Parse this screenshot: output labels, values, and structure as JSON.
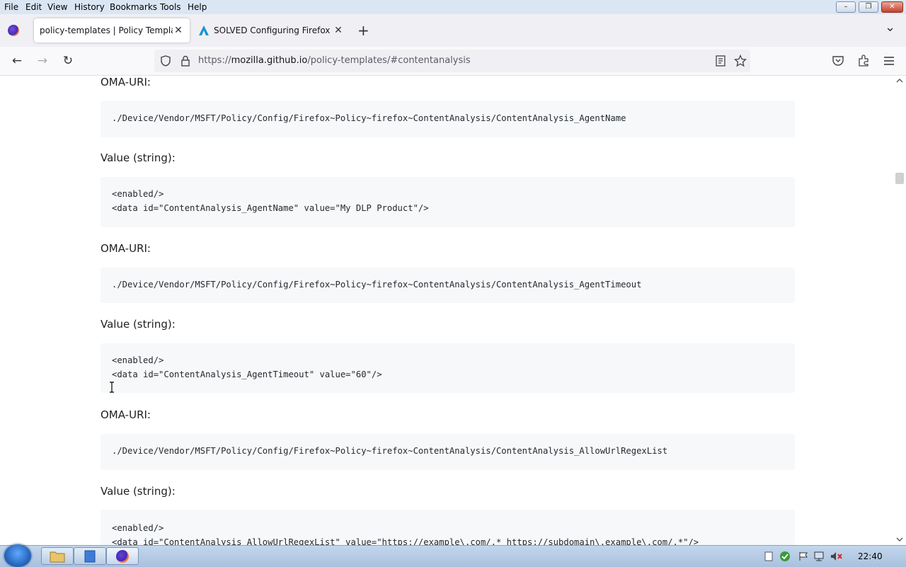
{
  "menu": [
    "File",
    "Edit",
    "View",
    "History",
    "Bookmarks",
    "Tools",
    "Help"
  ],
  "window_controls": {
    "minimize": "–",
    "restore": "❐",
    "close": "✕"
  },
  "tabs": [
    {
      "title": "policy-templates | Policy Templates",
      "close": "✕"
    },
    {
      "title": "SOLVED Configuring Firefox wit",
      "close": "✕"
    }
  ],
  "new_tab": "+",
  "tab_list": "⌄",
  "nav": {
    "back": "←",
    "forward": "→",
    "reload": "↻"
  },
  "url": {
    "scheme": "https://",
    "host": "mozilla.github.io",
    "path": "/policy-templates/#contentanalysis"
  },
  "content": {
    "label_oma": "OMA-URI:",
    "label_value": "Value (string):",
    "block1": "./Device/Vendor/MSFT/Policy/Config/Firefox~Policy~firefox~ContentAnalysis/ContentAnalysis_AgentName",
    "block2": "<enabled/>\n<data id=\"ContentAnalysis_AgentName\" value=\"My DLP Product\"/>",
    "block3": "./Device/Vendor/MSFT/Policy/Config/Firefox~Policy~firefox~ContentAnalysis/ContentAnalysis_AgentTimeout",
    "block4": "<enabled/>\n<data id=\"ContentAnalysis_AgentTimeout\" value=\"60\"/>",
    "block5": "./Device/Vendor/MSFT/Policy/Config/Firefox~Policy~firefox~ContentAnalysis/ContentAnalysis_AllowUrlRegexList",
    "block6": "<enabled/>\n<data id=\"ContentAnalysis_AllowUrlRegexList\" value=\"https://example\\.com/.* https://subdomain\\.example\\.com/.*\"/>"
  },
  "clock": "22:40",
  "colors": {
    "menubar": "#dbe6f4",
    "code_bg": "#f6f8fa",
    "taskbar": "#b6cbe4"
  }
}
